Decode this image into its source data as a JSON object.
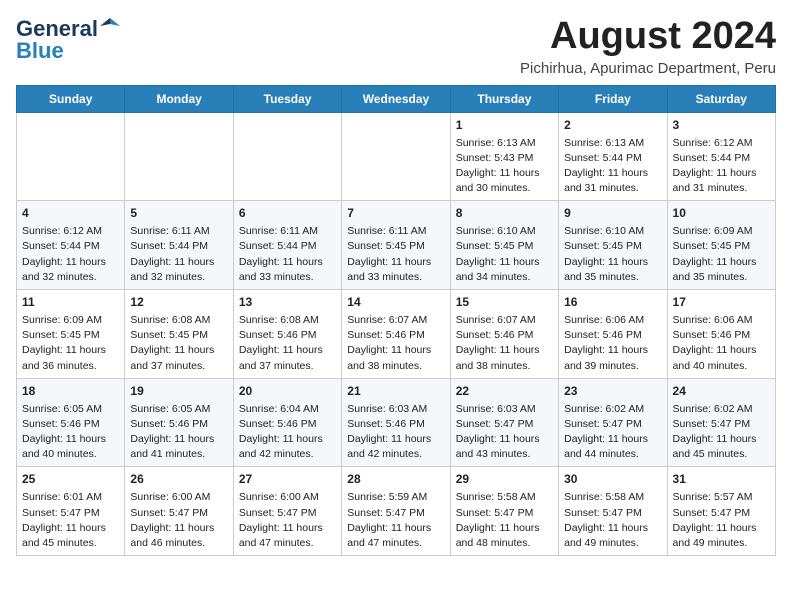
{
  "header": {
    "logo_line1": "General",
    "logo_line2": "Blue",
    "main_title": "August 2024",
    "subtitle": "Pichirhua, Apurimac Department, Peru"
  },
  "weekdays": [
    "Sunday",
    "Monday",
    "Tuesday",
    "Wednesday",
    "Thursday",
    "Friday",
    "Saturday"
  ],
  "weeks": [
    [
      {
        "day": "",
        "info": ""
      },
      {
        "day": "",
        "info": ""
      },
      {
        "day": "",
        "info": ""
      },
      {
        "day": "",
        "info": ""
      },
      {
        "day": "1",
        "info": "Sunrise: 6:13 AM\nSunset: 5:43 PM\nDaylight: 11 hours and 30 minutes."
      },
      {
        "day": "2",
        "info": "Sunrise: 6:13 AM\nSunset: 5:44 PM\nDaylight: 11 hours and 31 minutes."
      },
      {
        "day": "3",
        "info": "Sunrise: 6:12 AM\nSunset: 5:44 PM\nDaylight: 11 hours and 31 minutes."
      }
    ],
    [
      {
        "day": "4",
        "info": "Sunrise: 6:12 AM\nSunset: 5:44 PM\nDaylight: 11 hours and 32 minutes."
      },
      {
        "day": "5",
        "info": "Sunrise: 6:11 AM\nSunset: 5:44 PM\nDaylight: 11 hours and 32 minutes."
      },
      {
        "day": "6",
        "info": "Sunrise: 6:11 AM\nSunset: 5:44 PM\nDaylight: 11 hours and 33 minutes."
      },
      {
        "day": "7",
        "info": "Sunrise: 6:11 AM\nSunset: 5:45 PM\nDaylight: 11 hours and 33 minutes."
      },
      {
        "day": "8",
        "info": "Sunrise: 6:10 AM\nSunset: 5:45 PM\nDaylight: 11 hours and 34 minutes."
      },
      {
        "day": "9",
        "info": "Sunrise: 6:10 AM\nSunset: 5:45 PM\nDaylight: 11 hours and 35 minutes."
      },
      {
        "day": "10",
        "info": "Sunrise: 6:09 AM\nSunset: 5:45 PM\nDaylight: 11 hours and 35 minutes."
      }
    ],
    [
      {
        "day": "11",
        "info": "Sunrise: 6:09 AM\nSunset: 5:45 PM\nDaylight: 11 hours and 36 minutes."
      },
      {
        "day": "12",
        "info": "Sunrise: 6:08 AM\nSunset: 5:45 PM\nDaylight: 11 hours and 37 minutes."
      },
      {
        "day": "13",
        "info": "Sunrise: 6:08 AM\nSunset: 5:46 PM\nDaylight: 11 hours and 37 minutes."
      },
      {
        "day": "14",
        "info": "Sunrise: 6:07 AM\nSunset: 5:46 PM\nDaylight: 11 hours and 38 minutes."
      },
      {
        "day": "15",
        "info": "Sunrise: 6:07 AM\nSunset: 5:46 PM\nDaylight: 11 hours and 38 minutes."
      },
      {
        "day": "16",
        "info": "Sunrise: 6:06 AM\nSunset: 5:46 PM\nDaylight: 11 hours and 39 minutes."
      },
      {
        "day": "17",
        "info": "Sunrise: 6:06 AM\nSunset: 5:46 PM\nDaylight: 11 hours and 40 minutes."
      }
    ],
    [
      {
        "day": "18",
        "info": "Sunrise: 6:05 AM\nSunset: 5:46 PM\nDaylight: 11 hours and 40 minutes."
      },
      {
        "day": "19",
        "info": "Sunrise: 6:05 AM\nSunset: 5:46 PM\nDaylight: 11 hours and 41 minutes."
      },
      {
        "day": "20",
        "info": "Sunrise: 6:04 AM\nSunset: 5:46 PM\nDaylight: 11 hours and 42 minutes."
      },
      {
        "day": "21",
        "info": "Sunrise: 6:03 AM\nSunset: 5:46 PM\nDaylight: 11 hours and 42 minutes."
      },
      {
        "day": "22",
        "info": "Sunrise: 6:03 AM\nSunset: 5:47 PM\nDaylight: 11 hours and 43 minutes."
      },
      {
        "day": "23",
        "info": "Sunrise: 6:02 AM\nSunset: 5:47 PM\nDaylight: 11 hours and 44 minutes."
      },
      {
        "day": "24",
        "info": "Sunrise: 6:02 AM\nSunset: 5:47 PM\nDaylight: 11 hours and 45 minutes."
      }
    ],
    [
      {
        "day": "25",
        "info": "Sunrise: 6:01 AM\nSunset: 5:47 PM\nDaylight: 11 hours and 45 minutes."
      },
      {
        "day": "26",
        "info": "Sunrise: 6:00 AM\nSunset: 5:47 PM\nDaylight: 11 hours and 46 minutes."
      },
      {
        "day": "27",
        "info": "Sunrise: 6:00 AM\nSunset: 5:47 PM\nDaylight: 11 hours and 47 minutes."
      },
      {
        "day": "28",
        "info": "Sunrise: 5:59 AM\nSunset: 5:47 PM\nDaylight: 11 hours and 47 minutes."
      },
      {
        "day": "29",
        "info": "Sunrise: 5:58 AM\nSunset: 5:47 PM\nDaylight: 11 hours and 48 minutes."
      },
      {
        "day": "30",
        "info": "Sunrise: 5:58 AM\nSunset: 5:47 PM\nDaylight: 11 hours and 49 minutes."
      },
      {
        "day": "31",
        "info": "Sunrise: 5:57 AM\nSunset: 5:47 PM\nDaylight: 11 hours and 49 minutes."
      }
    ]
  ]
}
